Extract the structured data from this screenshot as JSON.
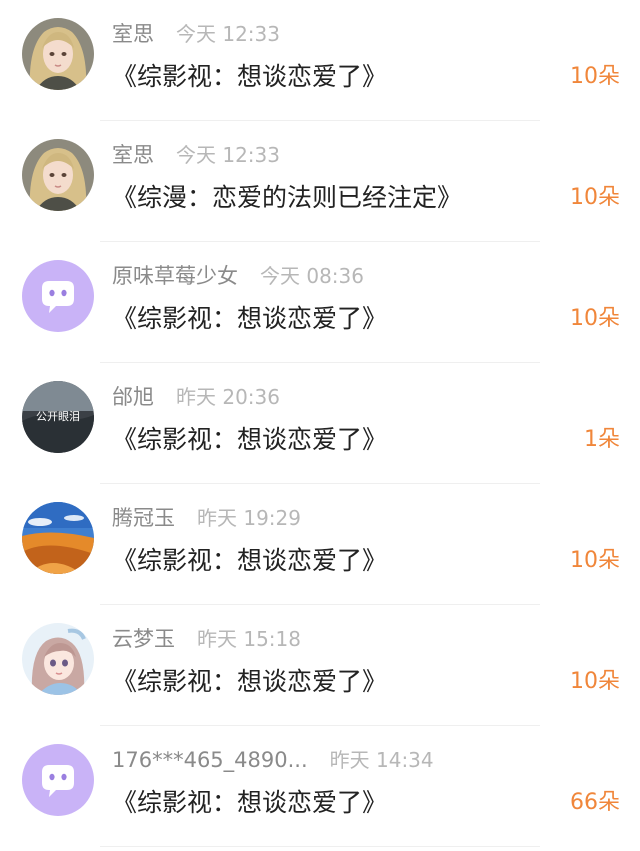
{
  "colors": {
    "count_orange": "#f0863a",
    "name_gray": "#8a8a8a",
    "time_gray": "#b7b7b7",
    "default_avatar_purple": "#c9b3f7"
  },
  "items": [
    {
      "avatar": "girl-portrait-avatar",
      "name": "室思",
      "time": "今天 12:33",
      "book": "《综影视：想谈恋爱了》",
      "count": "10朵"
    },
    {
      "avatar": "girl-portrait-avatar",
      "name": "室思",
      "time": "今天 12:33",
      "book": "《综漫：恋爱的法则已经注定》",
      "count": "10朵"
    },
    {
      "avatar": "default-chat-avatar",
      "name": "原味草莓少女",
      "time": "今天 08:36",
      "book": "《综影视：想谈恋爱了》",
      "count": "10朵"
    },
    {
      "avatar": "landscape-avatar",
      "avatar_text": "公开眼泪",
      "name": "邰旭",
      "time": "昨天 20:36",
      "book": "《综影视：想谈恋爱了》",
      "count": "1朵"
    },
    {
      "avatar": "desert-avatar",
      "name": "腾冠玉",
      "time": "昨天 19:29",
      "book": "《综影视：想谈恋爱了》",
      "count": "10朵"
    },
    {
      "avatar": "anime-girl-avatar",
      "name": "云梦玉",
      "time": "昨天 15:18",
      "book": "《综影视：想谈恋爱了》",
      "count": "10朵"
    },
    {
      "avatar": "default-chat-avatar",
      "name": "176***465_4890...",
      "time": "昨天 14:34",
      "book": "《综影视：想谈恋爱了》",
      "count": "66朵"
    }
  ]
}
